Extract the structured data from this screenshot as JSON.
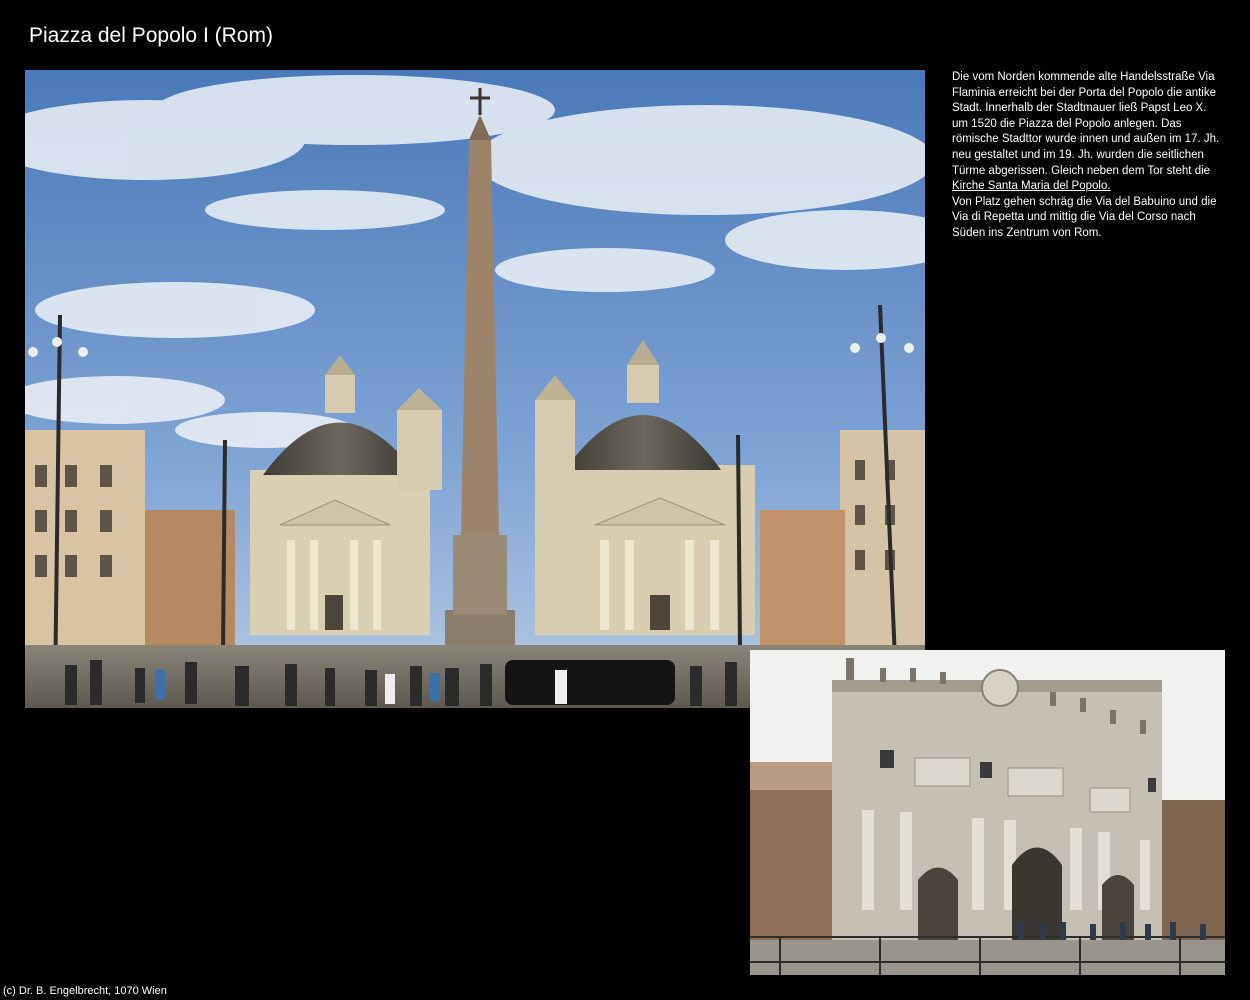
{
  "page": {
    "title": "Piazza del Popolo I (Rom)"
  },
  "description": {
    "text_before_link": "Die vom Norden kommende alte Handelsstraße Via Flaminia erreicht bei der Porta del Popolo die antike Stadt. Innerhalb der Stadtmauer ließ Papst Leo X. um 1520 die Piazza del Popolo anlegen. Das römische Stadttor wurde innen und außen im 17. Jh. neu gestaltet und im 19. Jh. wurden die seitlichen Türme abgerissen. Gleich neben dem Tor steht die",
    "link_text": "Kirche Santa Maria del Popolo.",
    "text_after_link": "Von Platz gehen schräg die Via del Babuino und die Via di Repetta und mittig die Via del Corso nach Süden ins Zentrum von Rom."
  },
  "footer": {
    "copyright": "(c) Dr. B. Engelbrecht, 1070 Wien"
  },
  "colors": {
    "background": "#000000",
    "text": "#ffffff",
    "sky": "#5b87c4",
    "stone": "#d9cfb2",
    "dome": "#57534c"
  }
}
